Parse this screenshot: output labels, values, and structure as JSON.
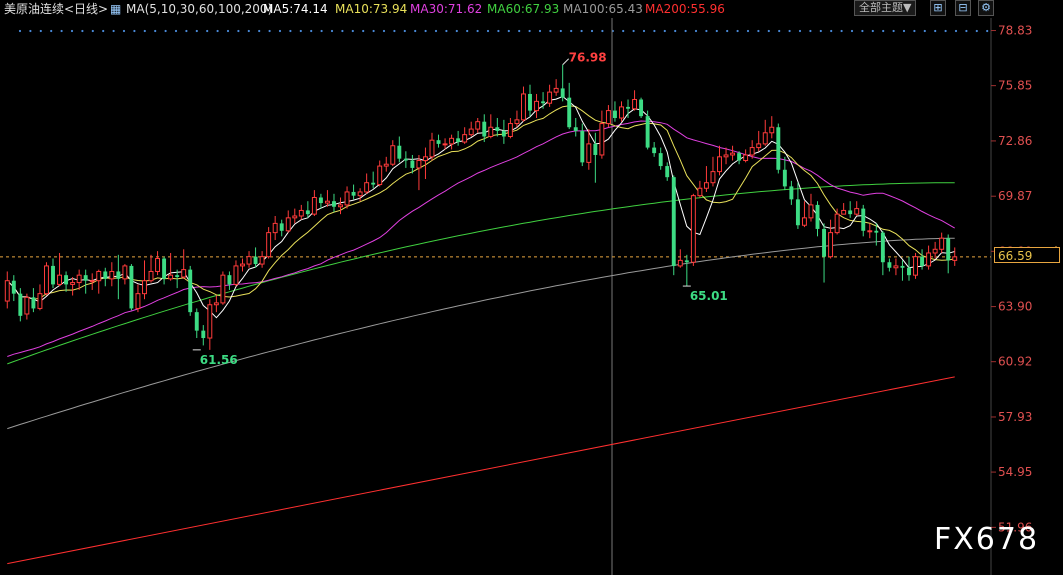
{
  "header": {
    "symbol": "美原油连续<日线>",
    "ma_icon": "ma-indicator-icon",
    "ma_params": "MA(5,10,30,60,100,200)",
    "ma5": "MA5:74.14",
    "ma10": "MA10:73.94",
    "ma30": "MA30:71.62",
    "ma60": "MA60:67.93",
    "ma100": "MA100:65.43",
    "ma200": "MA200:55.96",
    "theme_dropdown": "全部主题▼"
  },
  "toolbar": {
    "icons": [
      "grid-icon",
      "zoom-out-icon",
      "settings-icon"
    ]
  },
  "colors": {
    "up": "#ff3b3b",
    "down": "#3ddc84",
    "ma5": "#ffffff",
    "ma10": "#e8e05a",
    "ma30": "#e040e0",
    "ma60": "#40d040",
    "ma100": "#9a9a9a",
    "ma200": "#ff3030",
    "axis_text": "#e05050",
    "last_price": "#e8a640"
  },
  "watermark": "FX678",
  "last_price": "66.59",
  "chart_data": {
    "type": "candlestick",
    "y_axis": {
      "ticks": [
        78.83,
        75.85,
        72.86,
        69.87,
        66.89,
        63.9,
        60.92,
        57.93,
        54.95,
        51.96
      ],
      "range": [
        49.6,
        79.4
      ]
    },
    "annotations": [
      {
        "label": "76.98",
        "index": 85,
        "value": 76.98,
        "kind": "high"
      },
      {
        "label": "61.56",
        "index": 29,
        "value": 61.56,
        "kind": "low"
      },
      {
        "label": "65.01",
        "index": 104,
        "value": 65.01,
        "kind": "low"
      }
    ],
    "last_price_line": 66.59,
    "candles": [
      [
        64.2,
        65.3,
        65.8,
        63.8
      ],
      [
        65.3,
        64.6,
        65.6,
        64.2
      ],
      [
        64.6,
        63.4,
        64.9,
        63.1
      ],
      [
        63.5,
        64.4,
        64.6,
        63.2
      ],
      [
        64.4,
        63.8,
        64.9,
        63.6
      ],
      [
        63.8,
        64.6,
        65.1,
        63.7
      ],
      [
        64.6,
        66.1,
        66.3,
        64.5
      ],
      [
        66.1,
        65.1,
        66.5,
        64.9
      ],
      [
        65.1,
        65.6,
        66.8,
        65.0
      ],
      [
        65.6,
        65.1,
        65.8,
        64.7
      ],
      [
        65.1,
        65.2,
        65.5,
        64.5
      ],
      [
        65.2,
        65.6,
        65.9,
        64.8
      ],
      [
        65.6,
        65.3,
        65.9,
        64.6
      ],
      [
        65.3,
        65.3,
        65.7,
        64.8
      ],
      [
        65.3,
        65.8,
        65.9,
        64.6
      ],
      [
        65.8,
        65.4,
        66.0,
        65.0
      ],
      [
        65.4,
        65.8,
        66.3,
        65.0
      ],
      [
        65.8,
        65.4,
        66.7,
        64.3
      ],
      [
        65.4,
        66.1,
        66.2,
        65.1
      ],
      [
        66.1,
        63.8,
        66.2,
        63.7
      ],
      [
        63.8,
        64.6,
        65.1,
        63.6
      ],
      [
        64.6,
        65.3,
        66.4,
        64.3
      ],
      [
        65.3,
        65.8,
        66.7,
        65.2
      ],
      [
        65.8,
        66.5,
        66.9,
        65.6
      ],
      [
        66.5,
        65.4,
        66.6,
        65.1
      ],
      [
        65.4,
        65.6,
        66.8,
        65.3
      ],
      [
        65.6,
        65.5,
        65.9,
        64.9
      ],
      [
        65.5,
        65.9,
        67.0,
        65.4
      ],
      [
        65.9,
        63.6,
        66.1,
        63.4
      ],
      [
        63.6,
        62.6,
        63.8,
        62.2
      ],
      [
        62.6,
        62.2,
        62.9,
        61.8
      ],
      [
        62.2,
        64.0,
        64.3,
        61.56
      ],
      [
        64.0,
        64.1,
        64.5,
        63.6
      ],
      [
        64.1,
        65.6,
        65.8,
        64.0
      ],
      [
        65.6,
        65.1,
        65.8,
        64.8
      ],
      [
        65.1,
        66.1,
        66.4,
        65.0
      ],
      [
        66.1,
        66.2,
        66.5,
        65.8
      ],
      [
        66.2,
        66.6,
        66.9,
        66.0
      ],
      [
        66.6,
        66.2,
        67.1,
        66.0
      ],
      [
        66.2,
        66.6,
        66.9,
        66.0
      ],
      [
        66.6,
        67.9,
        68.2,
        66.5
      ],
      [
        67.9,
        68.4,
        68.8,
        67.5
      ],
      [
        68.4,
        68.0,
        68.6,
        67.7
      ],
      [
        68.0,
        68.7,
        69.1,
        67.9
      ],
      [
        68.7,
        68.8,
        69.2,
        68.4
      ],
      [
        68.8,
        69.1,
        69.4,
        68.6
      ],
      [
        69.1,
        68.9,
        69.6,
        68.7
      ],
      [
        68.9,
        69.8,
        70.2,
        68.8
      ],
      [
        69.8,
        69.5,
        70.0,
        69.2
      ],
      [
        69.5,
        69.6,
        70.2,
        69.3
      ],
      [
        69.6,
        69.3,
        70.0,
        69.0
      ],
      [
        69.3,
        69.4,
        69.8,
        68.9
      ],
      [
        69.4,
        70.1,
        70.4,
        69.2
      ],
      [
        70.1,
        69.9,
        70.5,
        69.7
      ],
      [
        69.9,
        70.1,
        70.3,
        69.6
      ],
      [
        70.1,
        70.6,
        71.1,
        70.0
      ],
      [
        70.6,
        70.5,
        71.2,
        70.3
      ],
      [
        70.5,
        71.5,
        71.8,
        70.4
      ],
      [
        71.5,
        71.6,
        72.0,
        71.2
      ],
      [
        71.6,
        72.6,
        72.9,
        71.5
      ],
      [
        72.6,
        71.9,
        73.1,
        71.7
      ],
      [
        71.9,
        71.8,
        72.3,
        71.4
      ],
      [
        71.8,
        71.4,
        72.1,
        71.1
      ],
      [
        71.4,
        71.8,
        72.1,
        70.2
      ],
      [
        71.8,
        72.0,
        72.5,
        70.8
      ],
      [
        72.0,
        72.9,
        73.3,
        71.8
      ],
      [
        72.9,
        72.7,
        73.2,
        72.5
      ],
      [
        72.7,
        72.7,
        73.0,
        72.4
      ],
      [
        72.7,
        73.0,
        73.2,
        72.4
      ],
      [
        73.0,
        72.8,
        73.4,
        72.6
      ],
      [
        72.8,
        73.2,
        73.6,
        72.7
      ],
      [
        73.2,
        73.5,
        73.9,
        73.1
      ],
      [
        73.5,
        73.9,
        74.1,
        73.3
      ],
      [
        73.9,
        73.1,
        74.3,
        72.8
      ],
      [
        73.1,
        73.6,
        74.3,
        73.0
      ],
      [
        73.6,
        73.4,
        74.1,
        73.1
      ],
      [
        73.4,
        73.1,
        74.0,
        72.7
      ],
      [
        73.1,
        73.8,
        74.1,
        73.0
      ],
      [
        73.8,
        74.0,
        74.5,
        73.6
      ],
      [
        74.0,
        75.4,
        75.8,
        73.9
      ],
      [
        75.4,
        74.5,
        75.9,
        74.2
      ],
      [
        74.5,
        75.0,
        75.4,
        74.1
      ],
      [
        75.0,
        74.9,
        75.5,
        74.6
      ],
      [
        74.9,
        75.5,
        75.9,
        74.7
      ],
      [
        75.5,
        75.7,
        76.2,
        75.3
      ],
      [
        75.7,
        75.2,
        76.98,
        75.0
      ],
      [
        75.2,
        73.6,
        76.0,
        73.5
      ],
      [
        73.6,
        73.4,
        74.1,
        73.1
      ],
      [
        73.4,
        71.7,
        73.8,
        71.5
      ],
      [
        71.7,
        72.7,
        73.5,
        71.3
      ],
      [
        72.7,
        72.1,
        73.3,
        70.6
      ],
      [
        72.1,
        73.8,
        74.5,
        71.9
      ],
      [
        73.8,
        74.5,
        74.8,
        73.6
      ],
      [
        74.5,
        74.1,
        75.0,
        73.9
      ],
      [
        74.1,
        74.7,
        75.0,
        73.9
      ],
      [
        74.7,
        74.6,
        75.1,
        74.1
      ],
      [
        74.6,
        75.1,
        75.6,
        74.5
      ],
      [
        75.1,
        74.2,
        75.2,
        74.1
      ],
      [
        74.2,
        72.5,
        74.5,
        72.4
      ],
      [
        72.5,
        72.2,
        72.8,
        72.0
      ],
      [
        72.2,
        71.5,
        72.5,
        71.3
      ],
      [
        71.5,
        70.9,
        71.7,
        70.7
      ],
      [
        70.9,
        66.1,
        71.0,
        65.6
      ],
      [
        66.1,
        66.4,
        67.0,
        66.0
      ],
      [
        66.4,
        66.3,
        66.7,
        65.01
      ],
      [
        66.3,
        69.9,
        70.0,
        66.1
      ],
      [
        69.9,
        70.3,
        70.7,
        69.8
      ],
      [
        70.3,
        70.6,
        71.5,
        70.1
      ],
      [
        70.6,
        71.2,
        72.0,
        70.4
      ],
      [
        71.2,
        72.0,
        72.6,
        71.0
      ],
      [
        72.0,
        72.1,
        72.5,
        71.6
      ],
      [
        72.1,
        72.2,
        72.6,
        71.8
      ],
      [
        72.2,
        71.8,
        72.3,
        71.6
      ],
      [
        71.8,
        72.1,
        72.4,
        71.7
      ],
      [
        72.1,
        72.5,
        72.9,
        71.9
      ],
      [
        72.5,
        72.7,
        73.4,
        72.3
      ],
      [
        72.7,
        73.3,
        74.0,
        72.6
      ],
      [
        73.3,
        73.6,
        74.2,
        73.0
      ],
      [
        73.6,
        71.3,
        73.8,
        71.1
      ],
      [
        71.3,
        70.4,
        72.0,
        70.2
      ],
      [
        70.4,
        69.7,
        70.7,
        69.4
      ],
      [
        69.7,
        68.3,
        70.6,
        68.1
      ],
      [
        68.3,
        68.7,
        69.6,
        68.2
      ],
      [
        68.7,
        69.4,
        70.0,
        68.5
      ],
      [
        69.4,
        68.1,
        69.6,
        67.7
      ],
      [
        68.1,
        66.6,
        68.4,
        65.2
      ],
      [
        66.6,
        67.9,
        68.6,
        66.5
      ],
      [
        67.9,
        68.9,
        69.2,
        67.8
      ],
      [
        68.9,
        69.1,
        69.5,
        68.9
      ],
      [
        69.1,
        68.9,
        69.6,
        68.7
      ],
      [
        68.9,
        69.2,
        69.6,
        68.8
      ],
      [
        69.2,
        68.0,
        69.4,
        67.7
      ],
      [
        68.0,
        68.0,
        68.4,
        67.6
      ],
      [
        68.0,
        67.9,
        68.4,
        67.2
      ],
      [
        67.9,
        66.3,
        68.0,
        65.6
      ],
      [
        66.3,
        66.0,
        66.5,
        65.8
      ],
      [
        66.0,
        66.1,
        66.5,
        65.6
      ],
      [
        66.1,
        66.0,
        66.4,
        65.3
      ],
      [
        66.0,
        65.6,
        66.6,
        65.3
      ],
      [
        65.6,
        66.6,
        66.8,
        65.4
      ],
      [
        66.6,
        66.1,
        67.0,
        65.9
      ],
      [
        66.1,
        66.8,
        67.2,
        65.9
      ],
      [
        66.8,
        67.0,
        67.4,
        66.5
      ],
      [
        67.0,
        67.6,
        67.9,
        66.8
      ],
      [
        67.6,
        66.4,
        67.8,
        65.7
      ],
      [
        66.4,
        66.59,
        67.1,
        66.1
      ]
    ]
  }
}
